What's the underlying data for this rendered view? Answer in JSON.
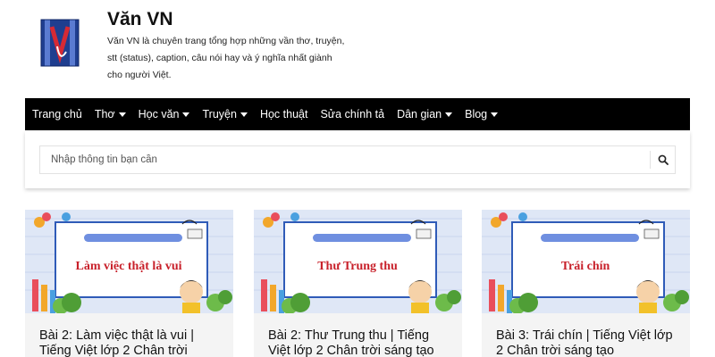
{
  "site": {
    "title": "Văn VN",
    "description": "Văn VN là chuyên trang tổng hợp những vần thơ, truyện, stt (status), caption, câu nói hay và ý nghĩa nhất giành cho người Việt."
  },
  "nav": {
    "items": [
      {
        "label": "Trang chủ",
        "has_dropdown": false
      },
      {
        "label": "Thơ",
        "has_dropdown": true
      },
      {
        "label": "Học văn",
        "has_dropdown": true
      },
      {
        "label": "Truyện",
        "has_dropdown": true
      },
      {
        "label": "Học thuật",
        "has_dropdown": false
      },
      {
        "label": "Sửa chính tả",
        "has_dropdown": false
      },
      {
        "label": "Dân gian",
        "has_dropdown": true
      },
      {
        "label": "Blog",
        "has_dropdown": true
      }
    ]
  },
  "search": {
    "placeholder": "Nhập thông tin bạn cần",
    "icon": "search-icon"
  },
  "cards": [
    {
      "thumb_text": "Làm việc thật là vui",
      "title": "Bài 2: Làm việc thật là vui | Tiếng Việt lớp 2 Chân trời"
    },
    {
      "thumb_text": "Thư Trung thu",
      "title": "Bài 2: Thư Trung thu | Tiếng Việt lớp 2 Chân trời sáng tạo"
    },
    {
      "thumb_text": "Trái chín",
      "title": "Bài 3: Trái chín | Tiếng Việt lớp 2 Chân trời sáng tạo"
    }
  ],
  "colors": {
    "nav_bg": "#000000",
    "thumb_text": "#c8202a",
    "thumb_bg": "#dfe7f6",
    "logo_blue": "#1f3e8f",
    "logo_red": "#d62a34"
  }
}
